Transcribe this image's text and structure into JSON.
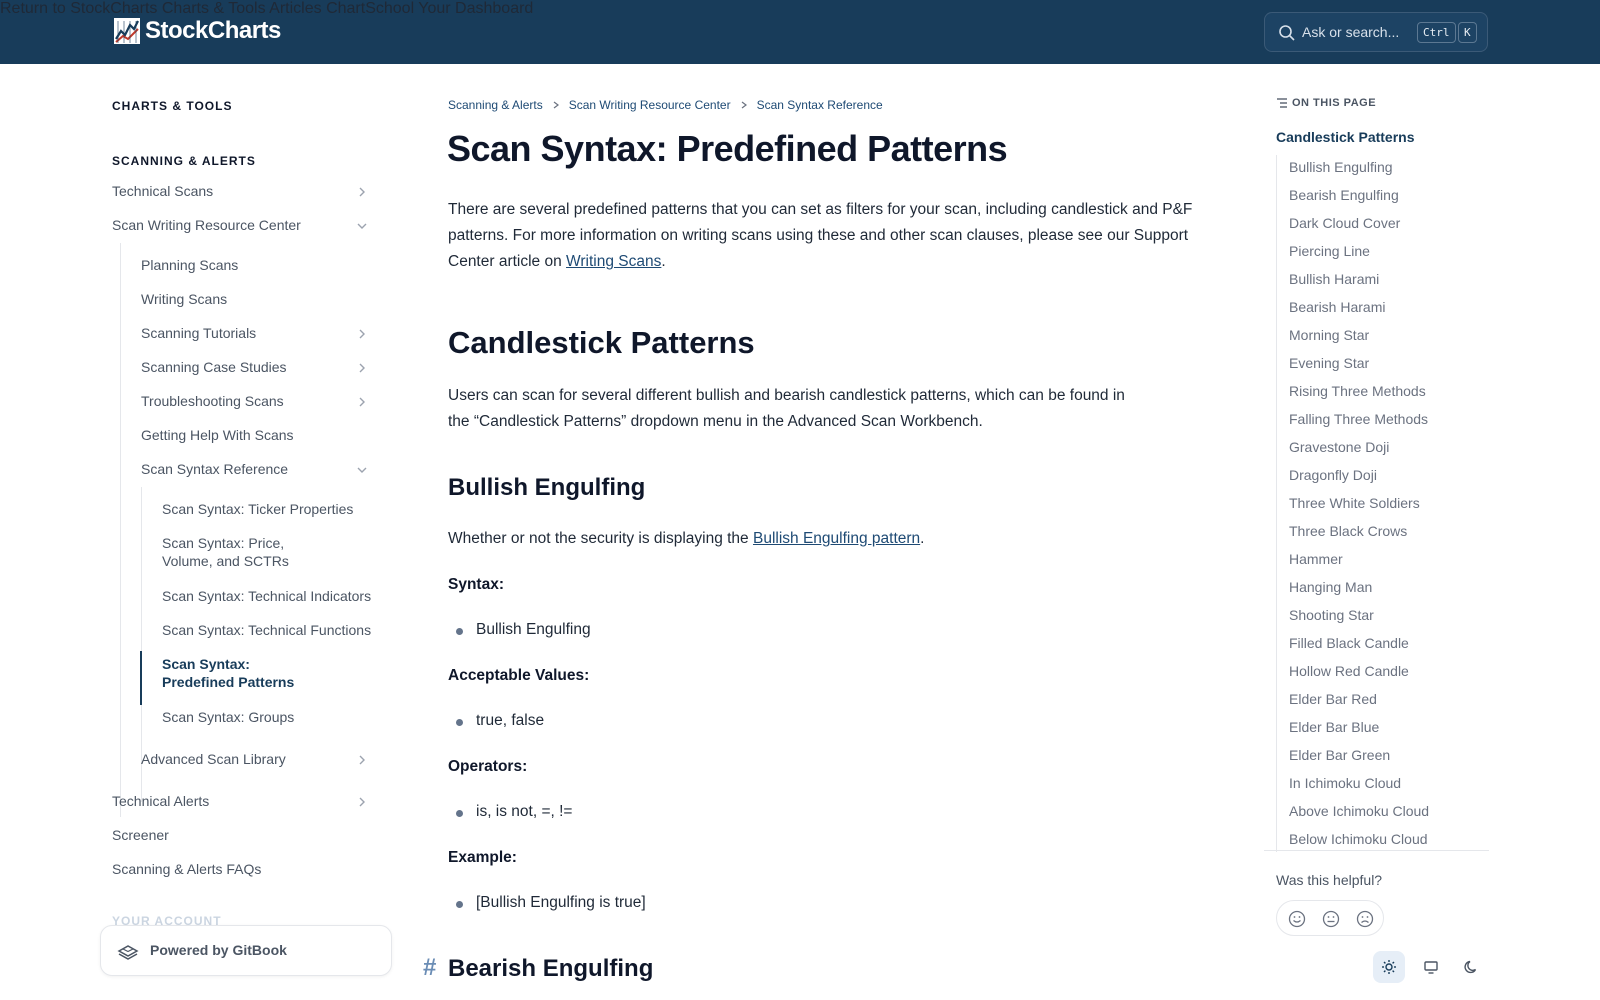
{
  "brand": {
    "name": "StockCharts"
  },
  "topnav": {
    "links": [
      "Return to StockCharts",
      "Charts & Tools",
      "Articles",
      "ChartSchool",
      "Your Dashboard"
    ],
    "search_placeholder": "Ask or search...",
    "kbd_ctrl": "Ctrl",
    "kbd_k": "K"
  },
  "sidebar": {
    "section1": "CHARTS & TOOLS",
    "section2": "SCANNING & ALERTS",
    "items": {
      "technical_scans": "Technical Scans",
      "scan_writing": "Scan Writing Resource Center",
      "planning": "Planning Scans",
      "writing": "Writing Scans",
      "tutorials": "Scanning Tutorials",
      "case_studies": "Scanning Case Studies",
      "troubleshooting": "Troubleshooting Scans",
      "help": "Getting Help With Scans",
      "syntax_ref": "Scan Syntax Reference",
      "ticker": "Scan Syntax: Ticker Properties",
      "price_line1": "Scan Syntax: Price,",
      "price_line2": "Volume, and SCTRs",
      "indicators": "Scan Syntax: Technical Indicators",
      "functions": "Scan Syntax: Technical Functions",
      "predefined_line1": "Scan Syntax:",
      "predefined_line2": "Predefined Patterns",
      "groups": "Scan Syntax: Groups",
      "adv_library": "Advanced Scan Library",
      "alerts": "Technical Alerts",
      "screener": "Screener",
      "faqs": "Scanning & Alerts FAQs"
    },
    "section3": "YOUR ACCOUNT",
    "powered": "Powered by GitBook"
  },
  "breadcrumb": [
    "Scanning & Alerts",
    "Scan Writing Resource Center",
    "Scan Syntax Reference"
  ],
  "page": {
    "title": "Scan Syntax: Predefined Patterns",
    "intro": "There are several predefined patterns that you can set as filters for your scan, including candlestick and P&F patterns. For more information on writing scans using these and other scan clauses, please see our Support Center article on ",
    "intro_link": "Writing Scans",
    "intro_end": ".",
    "h2_candles": "Candlestick Patterns",
    "candles_text": "Users can scan for several different bullish and bearish candlestick patterns, which can be found in the “Candlestick Patterns” dropdown menu in the Advanced Scan Workbench.",
    "h3_bullish": "Bullish Engulfing",
    "bullish_text": "Whether or not the security is displaying the ",
    "bullish_link": "Bullish Engulfing pattern",
    "bullish_end": ".",
    "syntax_label": "Syntax:",
    "syntax_value": "Bullish Engulfing",
    "values_label": "Acceptable Values:",
    "values_value": "true, false",
    "operators_label": "Operators:",
    "operators_value": "is, is not, =, !=",
    "example_label": "Example:",
    "example_value": "[Bullish Engulfing is true]",
    "hash": "#",
    "h3_bearish": "Bearish Engulfing"
  },
  "toc": {
    "heading": "ON THIS PAGE",
    "main": "Candlestick Patterns",
    "items": [
      "Bullish Engulfing",
      "Bearish Engulfing",
      "Dark Cloud Cover",
      "Piercing Line",
      "Bullish Harami",
      "Bearish Harami",
      "Morning Star",
      "Evening Star",
      "Rising Three Methods",
      "Falling Three Methods",
      "Gravestone Doji",
      "Dragonfly Doji",
      "Three White Soldiers",
      "Three Black Crows",
      "Hammer",
      "Hanging Man",
      "Shooting Star",
      "Filled Black Candle",
      "Hollow Red Candle",
      "Elder Bar Red",
      "Elder Bar Blue",
      "Elder Bar Green",
      "In Ichimoku Cloud",
      "Above Ichimoku Cloud",
      "Below Ichimoku Cloud"
    ],
    "helpful": "Was this helpful?"
  },
  "colors": {
    "header": "#183c5a",
    "link": "#1e4a74",
    "accent_bg": "#e6eef7"
  }
}
